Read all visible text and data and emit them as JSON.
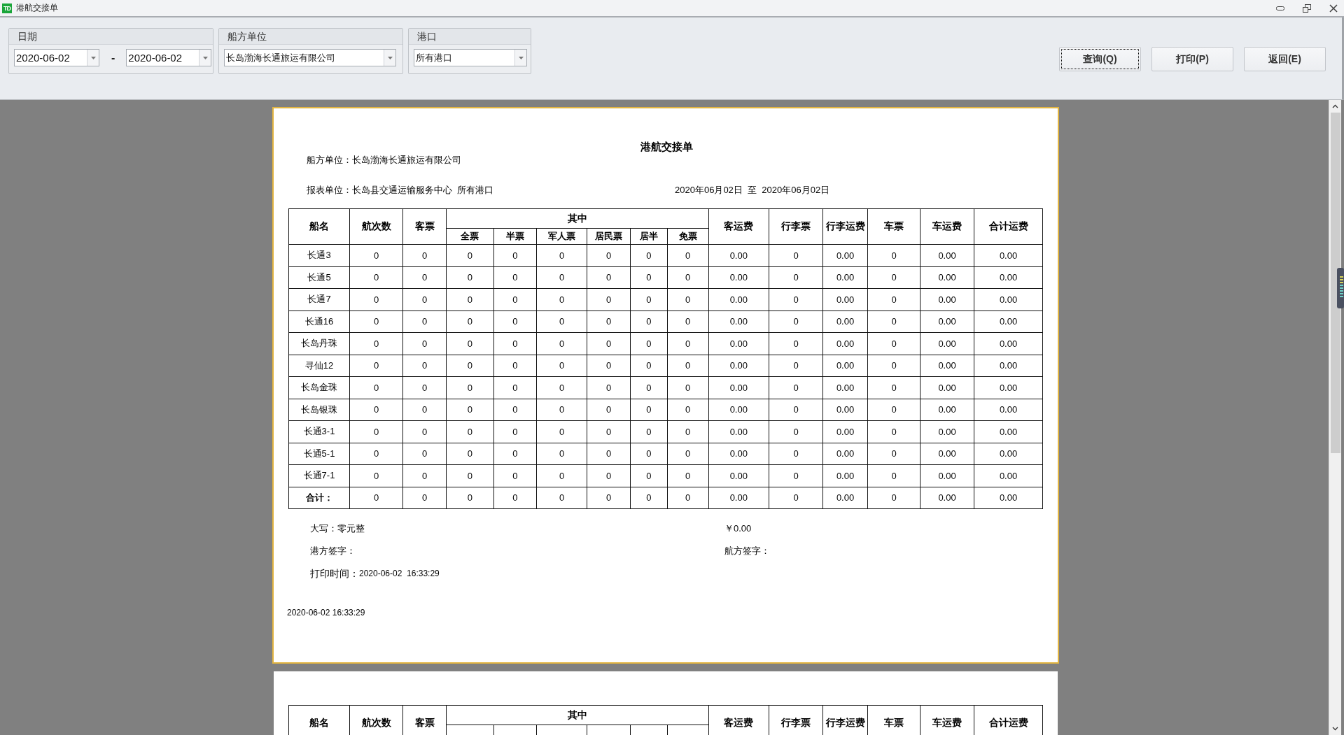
{
  "window": {
    "icon_label": "TD",
    "title": "港航交接单"
  },
  "filters": [
    {
      "kind": "date_range",
      "label": "日期",
      "from": "2020-06-02",
      "separator": "-",
      "to": "2020-06-02"
    },
    {
      "kind": "select",
      "label": "船方单位",
      "value": "长岛渤海长通旅运有限公司"
    },
    {
      "kind": "select",
      "label": "港口",
      "value": "所有港口"
    }
  ],
  "buttons": [
    {
      "label": "查询(Q)",
      "focused": true
    },
    {
      "label": "打印(P)",
      "focused": false
    },
    {
      "label": "返回(E)",
      "focused": false
    }
  ],
  "report": {
    "title": "港航交接单",
    "ship_unit": "船方单位：长岛渤海长通旅运有限公司",
    "report_unit": "报表单位：长岛县交通运输服务中心  所有港口",
    "date_range": "2020年06月02日  至  2020年06月02日",
    "group_header": "其中",
    "columns": [
      {
        "label": "船名",
        "in_group": false
      },
      {
        "label": "航次数",
        "in_group": false
      },
      {
        "label": "客票",
        "in_group": false
      },
      {
        "label": "全票",
        "in_group": true
      },
      {
        "label": "半票",
        "in_group": true
      },
      {
        "label": "军人票",
        "in_group": true
      },
      {
        "label": "居民票",
        "in_group": true
      },
      {
        "label": "居半",
        "in_group": true
      },
      {
        "label": "免票",
        "in_group": true
      },
      {
        "label": "客运费",
        "in_group": false
      },
      {
        "label": "行李票",
        "in_group": false
      },
      {
        "label": "行李运费",
        "in_group": false
      },
      {
        "label": "车票",
        "in_group": false
      },
      {
        "label": "车运费",
        "in_group": false
      },
      {
        "label": "合计运费",
        "in_group": false
      }
    ],
    "rows": [
      [
        "长通3",
        "0",
        "0",
        "0",
        "0",
        "0",
        "0",
        "0",
        "0",
        "0.00",
        "0",
        "0.00",
        "0",
        "0.00",
        "0.00"
      ],
      [
        "长通5",
        "0",
        "0",
        "0",
        "0",
        "0",
        "0",
        "0",
        "0",
        "0.00",
        "0",
        "0.00",
        "0",
        "0.00",
        "0.00"
      ],
      [
        "长通7",
        "0",
        "0",
        "0",
        "0",
        "0",
        "0",
        "0",
        "0",
        "0.00",
        "0",
        "0.00",
        "0",
        "0.00",
        "0.00"
      ],
      [
        "长通16",
        "0",
        "0",
        "0",
        "0",
        "0",
        "0",
        "0",
        "0",
        "0.00",
        "0",
        "0.00",
        "0",
        "0.00",
        "0.00"
      ],
      [
        "长岛丹珠",
        "0",
        "0",
        "0",
        "0",
        "0",
        "0",
        "0",
        "0",
        "0.00",
        "0",
        "0.00",
        "0",
        "0.00",
        "0.00"
      ],
      [
        "寻仙12",
        "0",
        "0",
        "0",
        "0",
        "0",
        "0",
        "0",
        "0",
        "0.00",
        "0",
        "0.00",
        "0",
        "0.00",
        "0.00"
      ],
      [
        "长岛金珠",
        "0",
        "0",
        "0",
        "0",
        "0",
        "0",
        "0",
        "0",
        "0.00",
        "0",
        "0.00",
        "0",
        "0.00",
        "0.00"
      ],
      [
        "长岛银珠",
        "0",
        "0",
        "0",
        "0",
        "0",
        "0",
        "0",
        "0",
        "0.00",
        "0",
        "0.00",
        "0",
        "0.00",
        "0.00"
      ],
      [
        "长通3-1",
        "0",
        "0",
        "0",
        "0",
        "0",
        "0",
        "0",
        "0",
        "0.00",
        "0",
        "0.00",
        "0",
        "0.00",
        "0.00"
      ],
      [
        "长通5-1",
        "0",
        "0",
        "0",
        "0",
        "0",
        "0",
        "0",
        "0",
        "0.00",
        "0",
        "0.00",
        "0",
        "0.00",
        "0.00"
      ],
      [
        "长通7-1",
        "0",
        "0",
        "0",
        "0",
        "0",
        "0",
        "0",
        "0",
        "0.00",
        "0",
        "0.00",
        "0",
        "0.00",
        "0.00"
      ]
    ],
    "total": [
      "合计：",
      "0",
      "0",
      "0",
      "0",
      "0",
      "0",
      "0",
      "0",
      "0.00",
      "0",
      "0.00",
      "0",
      "0.00",
      "0.00"
    ],
    "amount_words": "大写：零元整",
    "amount": "￥0.00",
    "port_sign": "港方签字：",
    "ship_sign": "航方签字：",
    "print_time_label": "打印时间：",
    "print_time": "2020-06-02  16:33:29",
    "page_footer": "2020-06-02 16:33:29"
  },
  "next_page": {
    "group_header": "其中",
    "columns": [
      {
        "label": "船名",
        "in_group": false
      },
      {
        "label": "航次数",
        "in_group": false
      },
      {
        "label": "客票",
        "in_group": false
      },
      {
        "in_group": true
      },
      {
        "in_group": true
      },
      {
        "in_group": true
      },
      {
        "in_group": true
      },
      {
        "in_group": true
      },
      {
        "in_group": true
      },
      {
        "label": "客运费",
        "in_group": false
      },
      {
        "label": "行李票",
        "in_group": false
      },
      {
        "label": "行李运费",
        "in_group": false
      },
      {
        "label": "车票",
        "in_group": false
      },
      {
        "label": "车运费",
        "in_group": false
      },
      {
        "label": "合计运费",
        "in_group": false
      }
    ]
  }
}
